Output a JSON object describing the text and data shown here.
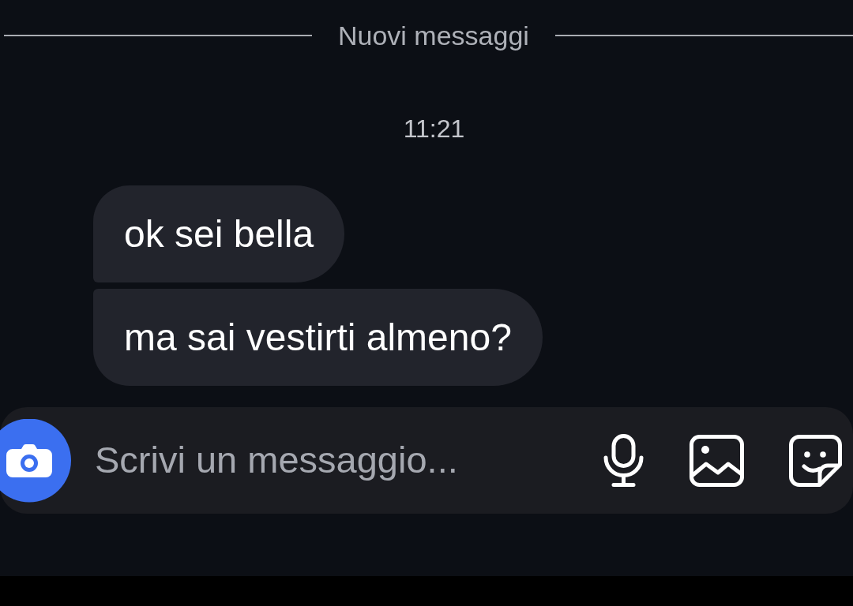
{
  "divider": {
    "label": "Nuovi messaggi"
  },
  "timestamp": "11:21",
  "messages": [
    {
      "text": "ok sei bella"
    },
    {
      "text": "ma sai vestirti almeno?"
    }
  ],
  "composer": {
    "placeholder": "Scrivi un messaggio..."
  }
}
